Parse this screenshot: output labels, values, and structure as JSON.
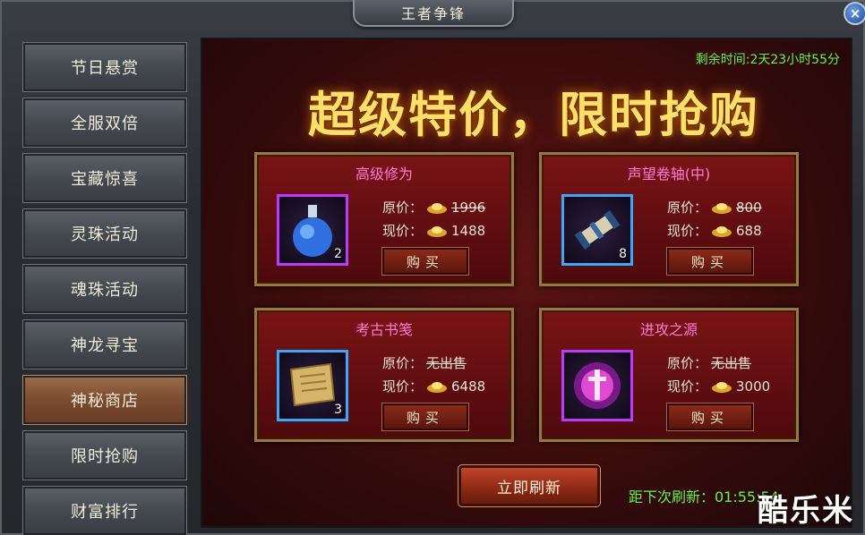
{
  "window": {
    "title": "王者争锋",
    "close_label": "×"
  },
  "sidebar": {
    "items": [
      {
        "label": "节日悬赏"
      },
      {
        "label": "全服双倍"
      },
      {
        "label": "宝藏惊喜"
      },
      {
        "label": "灵珠活动"
      },
      {
        "label": "魂珠活动"
      },
      {
        "label": "神龙寻宝"
      },
      {
        "label": "神秘商店",
        "active": true
      },
      {
        "label": "限时抢购"
      },
      {
        "label": "财富排行"
      }
    ]
  },
  "shop": {
    "remaining_time": "剩余时间:2天23小时55分",
    "banner": "超级特价，限时抢购",
    "original_price_label": "原价：",
    "current_price_label": "现价：",
    "buy_label": "购买",
    "items": [
      {
        "name": "高级修为",
        "count": "2",
        "original": "1996",
        "current": "1488",
        "icon": "blue-potion-icon",
        "frame_color": "#bb3aff"
      },
      {
        "name": "声望卷轴(中)",
        "count": "8",
        "original": "800",
        "current": "688",
        "icon": "scroll-case-icon",
        "frame_color": "#3aa8ff"
      },
      {
        "name": "考古书笺",
        "count": "3",
        "original": "无出售",
        "current": "6488",
        "icon": "parchment-icon",
        "frame_color": "#3aa8ff"
      },
      {
        "name": "进攻之源",
        "count": "",
        "original": "无出售",
        "current": "3000",
        "icon": "pink-orb-sword-icon",
        "frame_color": "#bb3aff"
      }
    ],
    "refresh_button": "立即刷新",
    "next_refresh": "距下次刷新：01:55:54"
  },
  "watermark": "酷乐米",
  "colors": {
    "accent_green": "#6cf04a",
    "card_title_pink": "#ff7ad6",
    "gold": "#ffdf6a"
  }
}
